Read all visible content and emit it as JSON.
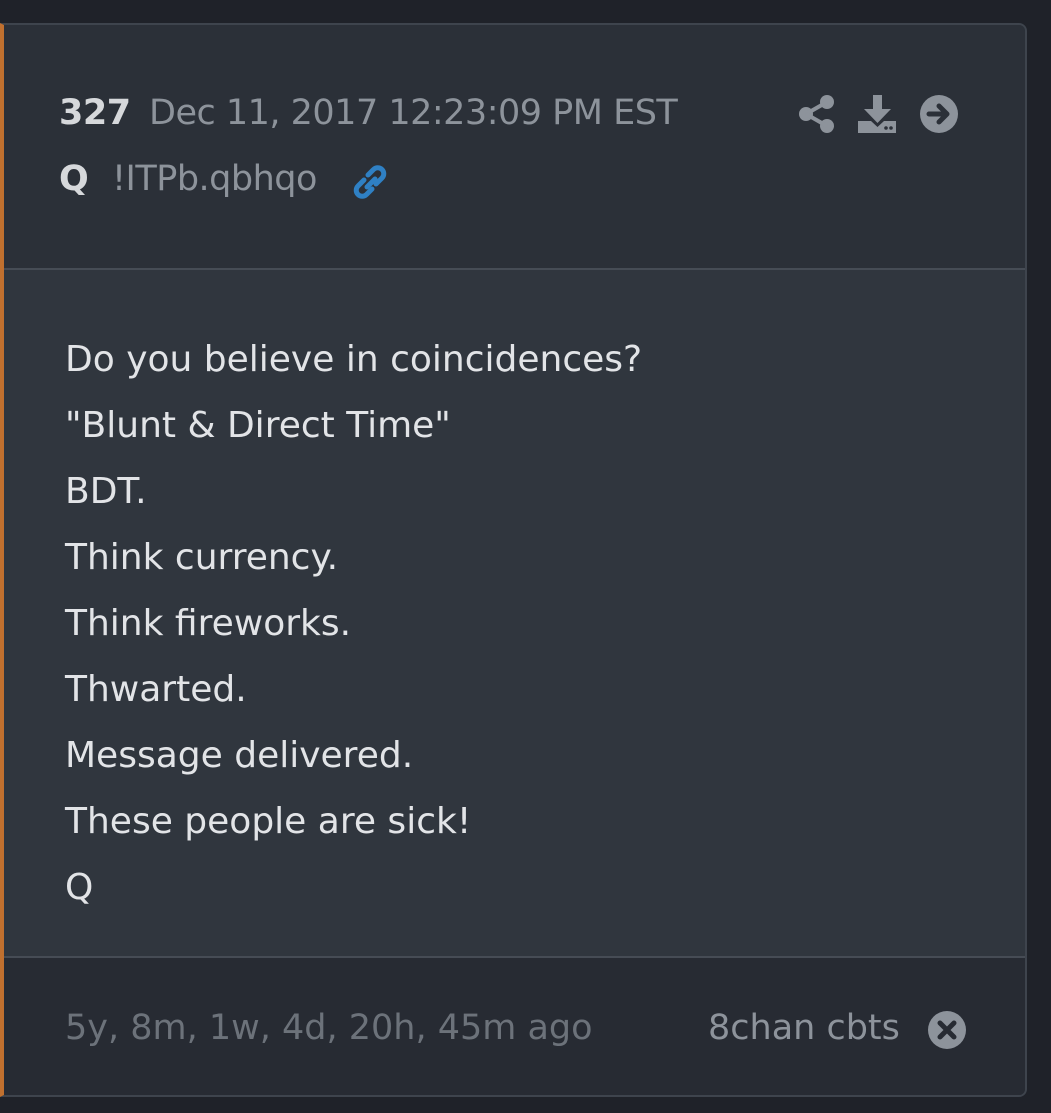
{
  "post": {
    "number": "327",
    "date": "Dec 11, 2017 12:23:09 PM EST",
    "author": "Q",
    "tripcode": "!ITPb.qbhqo",
    "icons": {
      "link": "link-icon",
      "share": "share-icon",
      "download": "download-icon",
      "goto": "arrow-circle-right-icon",
      "close": "close-circle-icon"
    },
    "lines": [
      "Do you believe in coincidences?",
      "\"Blunt & Direct Time\"",
      "BDT.",
      "Think currency.",
      "Think fireworks.",
      "Thwarted.",
      "Message delivered.",
      "These people are sick!",
      "Q"
    ],
    "age": "5y, 8m, 1w, 4d, 20h, 45m ago",
    "source": "8chan cbts"
  },
  "colors": {
    "accent_border": "#c0702f",
    "link_icon": "#2f80c4",
    "background": "#1f2229",
    "card_header": "#2b3038",
    "card_body": "#30363e",
    "card_footer": "#272b33"
  }
}
